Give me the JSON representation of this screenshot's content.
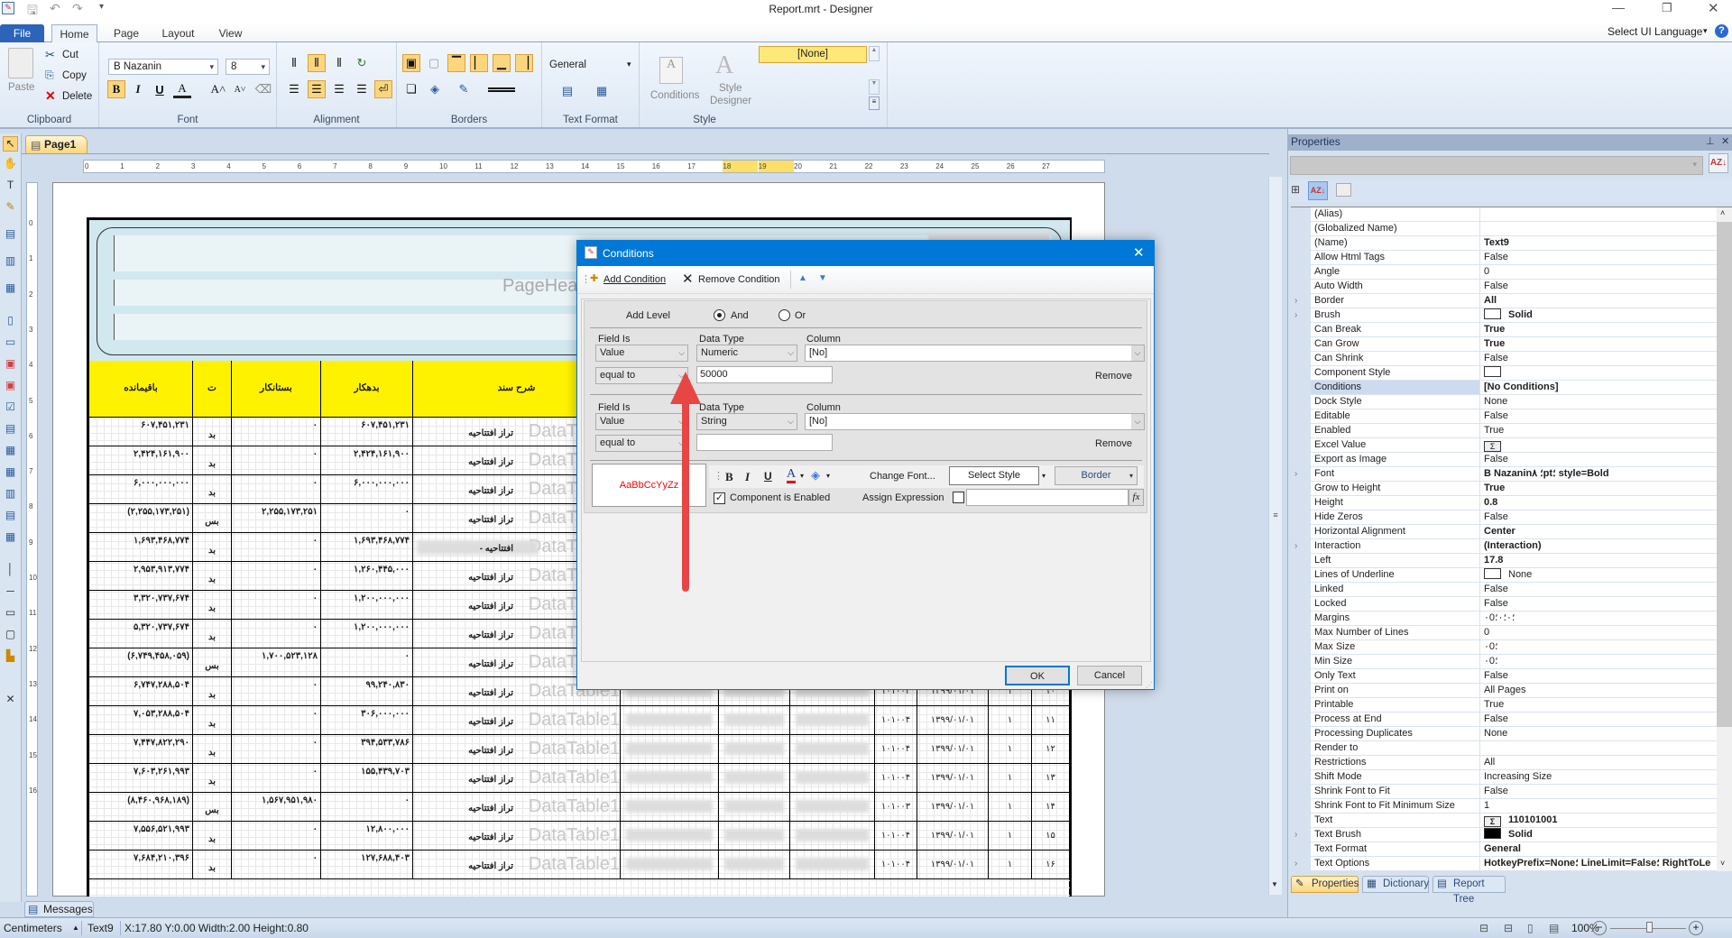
{
  "window": {
    "title": "Report.mrt  - Designer",
    "select_ui_language": "Select UI Language"
  },
  "ribbon": {
    "tabs": [
      "File",
      "Home",
      "Page",
      "Layout",
      "View"
    ],
    "active_tab": "Home",
    "clipboard": {
      "label": "Clipboard",
      "paste": "Paste",
      "cut": "Cut",
      "copy": "Copy",
      "delete": "Delete"
    },
    "font": {
      "label": "Font",
      "family": "B Nazanin",
      "size": "8"
    },
    "alignment": {
      "label": "Alignment"
    },
    "borders": {
      "label": "Borders"
    },
    "text_format": {
      "label": "Text Format",
      "format": "General"
    },
    "style": {
      "label": "Style",
      "conditions": "Conditions",
      "style_designer_1": "Style",
      "style_designer_2": "Designer",
      "gallery_selected": "[None]"
    }
  },
  "designer": {
    "page_tab": "Page1",
    "ruler": [
      "0",
      "1",
      "2",
      "3",
      "4",
      "5",
      "6",
      "7",
      "8",
      "9",
      "10",
      "11",
      "12",
      "13",
      "14",
      "15",
      "16",
      "17",
      "18",
      "19",
      "20",
      "21",
      "22",
      "23",
      "24",
      "25",
      "26",
      "27"
    ],
    "ruler_highlight": [
      "18",
      "19"
    ],
    "vruler": [
      "0",
      "1",
      "2",
      "3",
      "4",
      "5",
      "6",
      "7",
      "8",
      "9",
      "10",
      "11",
      "12",
      "13",
      "14",
      "15",
      "16"
    ],
    "page_header_watermark": "PageHeader",
    "band_watermark": "DataTable1",
    "header_color": "#fff200",
    "table_headers": [
      "باقیمانده",
      "ت",
      "بستانکار",
      "بدهکار",
      "شرح سند"
    ],
    "rows": [
      {
        "balance": "۶۰۷,۴۵۱,۲۳۱",
        "t": "بد",
        "credit": "۰",
        "debit": "۶۰۷,۴۵۱,۲۳۱",
        "desc": "تراز افتتاحیه"
      },
      {
        "balance": "۲,۴۲۴,۱۶۱,۹۰۰",
        "t": "بد",
        "credit": "۰",
        "debit": "۲,۴۲۴,۱۶۱,۹۰۰",
        "desc": "تراز افتتاحیه"
      },
      {
        "balance": "۶,۰۰۰,۰۰۰,۰۰۰",
        "t": "بد",
        "credit": "۰",
        "debit": "۶,۰۰۰,۰۰۰,۰۰۰",
        "desc": "تراز افتتاحیه"
      },
      {
        "balance": "(۲,۲۵۵,۱۷۳,۲۵۱)",
        "t": "بس",
        "credit": "۲,۲۵۵,۱۷۳,۲۵۱",
        "debit": "۰",
        "desc": "تراز افتتاحیه"
      },
      {
        "balance": "۱,۶۹۳,۴۶۸,۷۷۴",
        "t": "بد",
        "credit": "۰",
        "debit": "۱,۶۹۳,۴۶۸,۷۷۴",
        "desc": "افتتاحیه -"
      },
      {
        "balance": "۲,۹۵۳,۹۱۳,۷۷۴",
        "t": "بد",
        "credit": "۰",
        "debit": "۱,۲۶۰,۴۴۵,۰۰۰",
        "desc": "تراز افتتاحیه"
      },
      {
        "balance": "۳,۳۲۰,۷۳۷,۶۷۴",
        "t": "بد",
        "credit": "۰",
        "debit": "۱,۲۰۰,۰۰۰,۰۰۰",
        "desc": "تراز افتتاحیه"
      },
      {
        "balance": "۵,۳۲۰,۷۳۷,۶۷۴",
        "t": "بد",
        "credit": "۰",
        "debit": "۱,۲۰۰,۰۰۰,۰۰۰",
        "desc": "تراز افتتاحیه"
      },
      {
        "balance": "(۶,۷۴۹,۴۵۸,۰۵۹)",
        "t": "بس",
        "credit": "۱,۷۰۰,۵۲۳,۱۲۸",
        "debit": "۰",
        "desc": "تراز افتتاحیه"
      },
      {
        "balance": "۶,۷۴۷,۲۸۸,۵۰۴",
        "t": "بد",
        "credit": "۰",
        "debit": "۹۹,۲۴۰,۸۳۰",
        "desc": "تراز افتتاحیه",
        "code": "۱۰۱۰۰۴",
        "date": "۱۳۹۹/۰۱/۰۱",
        "one": "۱",
        "no": "۱۰"
      },
      {
        "balance": "۷,۰۵۳,۲۸۸,۵۰۴",
        "t": "بد",
        "credit": "۰",
        "debit": "۳۰۶,۰۰۰,۰۰۰",
        "desc": "تراز افتتاحیه",
        "code": "۱۰۱۰۰۴",
        "date": "۱۳۹۹/۰۱/۰۱",
        "one": "۱",
        "no": "۱۱"
      },
      {
        "balance": "۷,۴۴۷,۸۲۲,۲۹۰",
        "t": "بد",
        "credit": "۰",
        "debit": "۳۹۴,۵۳۳,۷۸۶",
        "desc": "تراز افتتاحیه",
        "code": "۱۰۱۰۰۴",
        "date": "۱۳۹۹/۰۱/۰۱",
        "one": "۱",
        "no": "۱۲"
      },
      {
        "balance": "۷,۶۰۳,۲۶۱,۹۹۳",
        "t": "بد",
        "credit": "۰",
        "debit": "۱۵۵,۴۳۹,۷۰۳",
        "desc": "تراز افتتاحیه",
        "code": "۱۰۱۰۰۴",
        "date": "۱۳۹۹/۰۱/۰۱",
        "one": "۱",
        "no": "۱۳"
      },
      {
        "balance": "(۸,۴۶۰,۹۶۸,۱۸۹)",
        "t": "بس",
        "credit": "۱,۵۶۷,۹۵۱,۹۸۰",
        "debit": "۰",
        "desc": "تراز افتتاحیه",
        "code": "۱۰۱۰۰۳",
        "date": "۱۳۹۹/۰۱/۰۱",
        "one": "۱",
        "no": "۱۴"
      },
      {
        "balance": "۷,۵۵۶,۵۲۱,۹۹۳",
        "t": "بد",
        "credit": "۰",
        "debit": "۱۲,۸۰۰,۰۰۰",
        "desc": "تراز افتتاحیه",
        "code": "۱۰۱۰۰۴",
        "date": "۱۳۹۹/۰۱/۰۱",
        "one": "۱",
        "no": "۱۵"
      },
      {
        "balance": "۷,۶۸۴,۲۱۰,۳۹۶",
        "t": "بد",
        "credit": "۰",
        "debit": "۱۲۷,۶۸۸,۴۰۳",
        "desc": "تراز افتتاحیه",
        "code": "۱۰۱۰۰۴",
        "date": "۱۳۹۹/۰۱/۰۱",
        "one": "۱",
        "no": "۱۶"
      }
    ]
  },
  "dialog": {
    "title": "Conditions",
    "add_condition": "Add Condition",
    "remove_condition": "Remove Condition",
    "add_level": "Add Level",
    "and": "And",
    "or": "Or",
    "logic_selected": "And",
    "conditions": [
      {
        "field_is_label": "Field Is",
        "data_type_label": "Data Type",
        "column_label": "Column",
        "field_is": "Value",
        "data_type": "Numeric",
        "column": "[No]",
        "operator": "equal to",
        "value": "50000",
        "remove": "Remove"
      },
      {
        "field_is_label": "Field Is",
        "data_type_label": "Data Type",
        "column_label": "Column",
        "field_is": "Value",
        "data_type": "String",
        "column": "[No]",
        "operator": "equal to",
        "value": "",
        "remove": "Remove"
      }
    ],
    "preview_text": "AaBbCcYyZz",
    "preview_color": "#ff0000",
    "bold": "B",
    "italic": "I",
    "underline": "U",
    "change_font": "Change Font...",
    "select_style": "Select Style",
    "border": "Border",
    "component_enabled": "Component is Enabled",
    "component_enabled_checked": true,
    "assign_expression": "Assign Expression",
    "assign_expression_checked": false,
    "fx": "fx",
    "ok": "OK",
    "cancel": "Cancel",
    "annotation_arrow_color": "#e84545"
  },
  "properties": {
    "title": "Properties",
    "rows": [
      {
        "name": "(Alias)",
        "value": ""
      },
      {
        "name": "(Globalized Name)",
        "value": ""
      },
      {
        "name": "(Name)",
        "value": "Text9",
        "bold": true
      },
      {
        "name": "Allow Html Tags",
        "value": "False"
      },
      {
        "name": "Angle",
        "value": "0"
      },
      {
        "name": "Auto Width",
        "value": "False"
      },
      {
        "name": "Border",
        "value": "All",
        "bold": true,
        "expand": true
      },
      {
        "name": "Brush",
        "value": "Solid",
        "bold": true,
        "expand": true,
        "swatch": "#ffffff"
      },
      {
        "name": "Can Break",
        "value": "True",
        "bold": true
      },
      {
        "name": "Can Grow",
        "value": "True",
        "bold": true
      },
      {
        "name": "Can Shrink",
        "value": "False"
      },
      {
        "name": "Component Style",
        "value": "",
        "swatch": "#ffffff"
      },
      {
        "name": "Conditions",
        "value": "[No Conditions]",
        "bold": true,
        "selected": true
      },
      {
        "name": "Dock Style",
        "value": "None"
      },
      {
        "name": "Editable",
        "value": "False"
      },
      {
        "name": "Enabled",
        "value": "True"
      },
      {
        "name": "Excel Value",
        "value": "",
        "sigma": true
      },
      {
        "name": "Export as Image",
        "value": "False"
      },
      {
        "name": "Font",
        "value": "B Nazanin؛ ۸pt؛ style=Bold",
        "bold": true,
        "expand": true
      },
      {
        "name": "Grow to Height",
        "value": "True",
        "bold": true
      },
      {
        "name": "Height",
        "value": "0.8",
        "bold": true
      },
      {
        "name": "Hide Zeros",
        "value": "False"
      },
      {
        "name": "Horizontal Alignment",
        "value": "Center",
        "bold": true
      },
      {
        "name": "Interaction",
        "value": "(Interaction)",
        "bold": true,
        "expand": true
      },
      {
        "name": "Left",
        "value": "17.8",
        "bold": true
      },
      {
        "name": "Lines of Underline",
        "value": "None",
        "swatch": "#ffffff"
      },
      {
        "name": "Linked",
        "value": "False"
      },
      {
        "name": "Locked",
        "value": "False"
      },
      {
        "name": "Margins",
        "value": "۰؛۰؛۰؛0"
      },
      {
        "name": "Max Number of Lines",
        "value": "0"
      },
      {
        "name": "Max Size",
        "value": "۰؛0"
      },
      {
        "name": "Min Size",
        "value": "۰؛0"
      },
      {
        "name": "Only Text",
        "value": "False"
      },
      {
        "name": "Print on",
        "value": "All Pages"
      },
      {
        "name": "Printable",
        "value": "True"
      },
      {
        "name": "Process at End",
        "value": "False"
      },
      {
        "name": "Processing Duplicates",
        "value": "None"
      },
      {
        "name": "Render to",
        "value": ""
      },
      {
        "name": "Restrictions",
        "value": "All"
      },
      {
        "name": "Shift Mode",
        "value": "Increasing Size"
      },
      {
        "name": "Shrink Font to Fit",
        "value": "False"
      },
      {
        "name": "Shrink Font to Fit Minimum Size",
        "value": "1"
      },
      {
        "name": "Text",
        "value": "110101001",
        "bold": true,
        "sigma": true
      },
      {
        "name": "Text Brush",
        "value": "Solid",
        "bold": true,
        "expand": true,
        "swatch": "#000000"
      },
      {
        "name": "Text Format",
        "value": "General",
        "bold": true
      },
      {
        "name": "Text Options",
        "value": "HotkeyPrefix=None؛ LineLimit=False؛ RightToLe",
        "bold": true,
        "expand": true
      }
    ],
    "tabs": [
      "Properties",
      "Dictionary",
      "Report Tree"
    ]
  },
  "messages_tab": "Messages",
  "status": {
    "units": "Centimeters",
    "component": "Text9",
    "position": "X:17.80  Y:0.00  Width:2.00  Height:0.80",
    "zoom": "100%",
    "zoom_percent": 100
  }
}
